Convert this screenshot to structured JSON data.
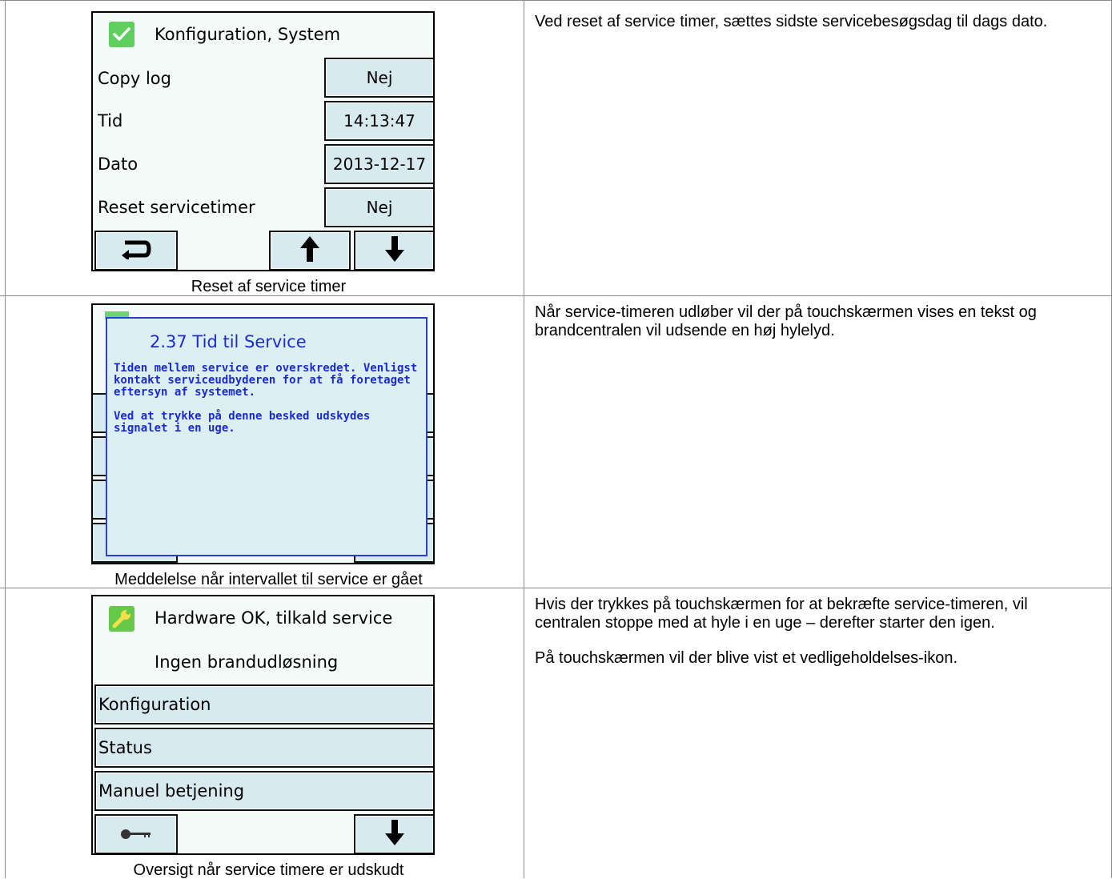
{
  "rows": [
    {
      "caption": "Reset af service timer",
      "description": [
        "Ved reset af service timer, sættes sidste servicebesøgsdag til dags dato."
      ],
      "screen": {
        "title": "Konfiguration, System",
        "title_icon": "check-icon",
        "fields": [
          {
            "label": "Copy log",
            "value": "Nej"
          },
          {
            "label": "Tid",
            "value": "14:13:47"
          },
          {
            "label": "Dato",
            "value": "2013-12-17"
          },
          {
            "label": "Reset servicetimer",
            "value": "Nej"
          }
        ],
        "nav": [
          "return-icon",
          "arrow-up-icon",
          "arrow-down-icon"
        ]
      }
    },
    {
      "caption": "Meddelelse når intervallet til service er gået",
      "description": [
        "Når service-timeren udløber vil der på touchskærmen vises en tekst og brandcentralen vil udsende en høj hylelyd."
      ],
      "dialog": {
        "title": "2.37 Tid til Service",
        "body": [
          "Tiden mellem service er overskredet. Venligst kontakt serviceudbyderen for at få foretaget eftersyn af systemet.",
          "Ved at trykke på denne besked udskydes signalet i en uge."
        ]
      }
    },
    {
      "caption": "Oversigt når service timere er udskudt",
      "description": [
        "Hvis der trykkes på touchskærmen for at bekræfte service-timeren, vil centralen stoppe med at hyle i en uge – derefter starter den igen.",
        "På touchskærmen vil der blive vist et vedligeholdelses-ikon."
      ],
      "screen": {
        "title": "Hardware OK, tilkald service",
        "title_icon": "wrench-icon",
        "status": "Ingen brandudløsning",
        "menu": [
          "Konfiguration",
          "Status",
          "Manuel betjening"
        ],
        "nav": [
          "key-icon",
          "arrow-down-icon"
        ]
      }
    }
  ],
  "colors": {
    "screen_bg": "#f4fbf8",
    "button_bg": "#d6eaf0",
    "dialog_text": "#1c2bd0",
    "ok_green": "#5fcf5f"
  }
}
